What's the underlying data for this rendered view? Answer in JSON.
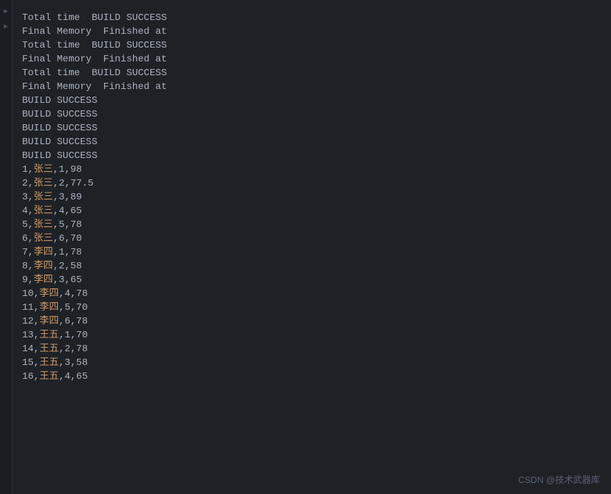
{
  "terminal": {
    "background": "#1e2227",
    "lines": [
      {
        "type": "normal",
        "text": "Total time  BUILD SUCCESS"
      },
      {
        "type": "normal",
        "text": "Final Memory  Finished at"
      },
      {
        "type": "normal",
        "text": "Total time  BUILD SUCCESS"
      },
      {
        "type": "normal",
        "text": "Final Memory  Finished at"
      },
      {
        "type": "normal",
        "text": "Total time  BUILD SUCCESS"
      },
      {
        "type": "normal",
        "text": "Final Memory  Finished at"
      },
      {
        "type": "normal",
        "text": "BUILD SUCCESS"
      },
      {
        "type": "normal",
        "text": "BUILD SUCCESS"
      },
      {
        "type": "normal",
        "text": "BUILD SUCCESS"
      },
      {
        "type": "normal",
        "text": "BUILD SUCCESS"
      },
      {
        "type": "normal",
        "text": "BUILD SUCCESS"
      },
      {
        "type": "mixed",
        "parts": [
          {
            "text": "1,",
            "color": "normal"
          },
          {
            "text": "张三",
            "color": "orange"
          },
          {
            "text": ",1,98",
            "color": "normal"
          }
        ]
      },
      {
        "type": "mixed",
        "parts": [
          {
            "text": "2,",
            "color": "normal"
          },
          {
            "text": "张三",
            "color": "orange"
          },
          {
            "text": ",2,77.5",
            "color": "normal"
          }
        ]
      },
      {
        "type": "mixed",
        "parts": [
          {
            "text": "3,",
            "color": "normal"
          },
          {
            "text": "张三",
            "color": "orange"
          },
          {
            "text": ",3,89",
            "color": "normal"
          }
        ]
      },
      {
        "type": "mixed",
        "parts": [
          {
            "text": "4,",
            "color": "normal"
          },
          {
            "text": "张三",
            "color": "orange"
          },
          {
            "text": ",4,65",
            "color": "normal"
          }
        ]
      },
      {
        "type": "mixed",
        "parts": [
          {
            "text": "5,",
            "color": "normal"
          },
          {
            "text": "张三",
            "color": "orange"
          },
          {
            "text": ",5,78",
            "color": "normal"
          }
        ]
      },
      {
        "type": "mixed",
        "parts": [
          {
            "text": "6,",
            "color": "normal"
          },
          {
            "text": "张三",
            "color": "orange"
          },
          {
            "text": ",6,70",
            "color": "normal"
          }
        ]
      },
      {
        "type": "mixed",
        "parts": [
          {
            "text": "7,",
            "color": "normal"
          },
          {
            "text": "李四",
            "color": "orange"
          },
          {
            "text": ",1,78",
            "color": "normal"
          }
        ]
      },
      {
        "type": "mixed",
        "parts": [
          {
            "text": "8,",
            "color": "normal"
          },
          {
            "text": "李四",
            "color": "orange"
          },
          {
            "text": ",2,58",
            "color": "normal"
          }
        ]
      },
      {
        "type": "mixed",
        "parts": [
          {
            "text": "9,",
            "color": "normal"
          },
          {
            "text": "李四",
            "color": "orange"
          },
          {
            "text": ",3,65",
            "color": "normal"
          }
        ]
      },
      {
        "type": "mixed",
        "parts": [
          {
            "text": "10,",
            "color": "normal"
          },
          {
            "text": "李四",
            "color": "orange"
          },
          {
            "text": ",4,78",
            "color": "normal"
          }
        ]
      },
      {
        "type": "mixed",
        "parts": [
          {
            "text": "11,",
            "color": "normal"
          },
          {
            "text": "李四",
            "color": "orange"
          },
          {
            "text": ",5,70",
            "color": "normal"
          }
        ]
      },
      {
        "type": "mixed",
        "parts": [
          {
            "text": "12,",
            "color": "normal"
          },
          {
            "text": "李四",
            "color": "orange"
          },
          {
            "text": ",6,78",
            "color": "normal"
          }
        ]
      },
      {
        "type": "mixed",
        "parts": [
          {
            "text": "13,",
            "color": "normal"
          },
          {
            "text": "王五",
            "color": "orange"
          },
          {
            "text": ",1,70",
            "color": "normal"
          }
        ]
      },
      {
        "type": "mixed",
        "parts": [
          {
            "text": "14,",
            "color": "normal"
          },
          {
            "text": "王五",
            "color": "orange"
          },
          {
            "text": ",2,78",
            "color": "normal"
          }
        ]
      },
      {
        "type": "mixed",
        "parts": [
          {
            "text": "15,",
            "color": "normal"
          },
          {
            "text": "王五",
            "color": "orange"
          },
          {
            "text": ",3,58",
            "color": "normal"
          }
        ]
      },
      {
        "type": "mixed",
        "parts": [
          {
            "text": "16,",
            "color": "normal"
          },
          {
            "text": "王五",
            "color": "orange"
          },
          {
            "text": ",4,65",
            "color": "normal"
          }
        ]
      }
    ],
    "watermark": "CSDN @技术武器库"
  }
}
